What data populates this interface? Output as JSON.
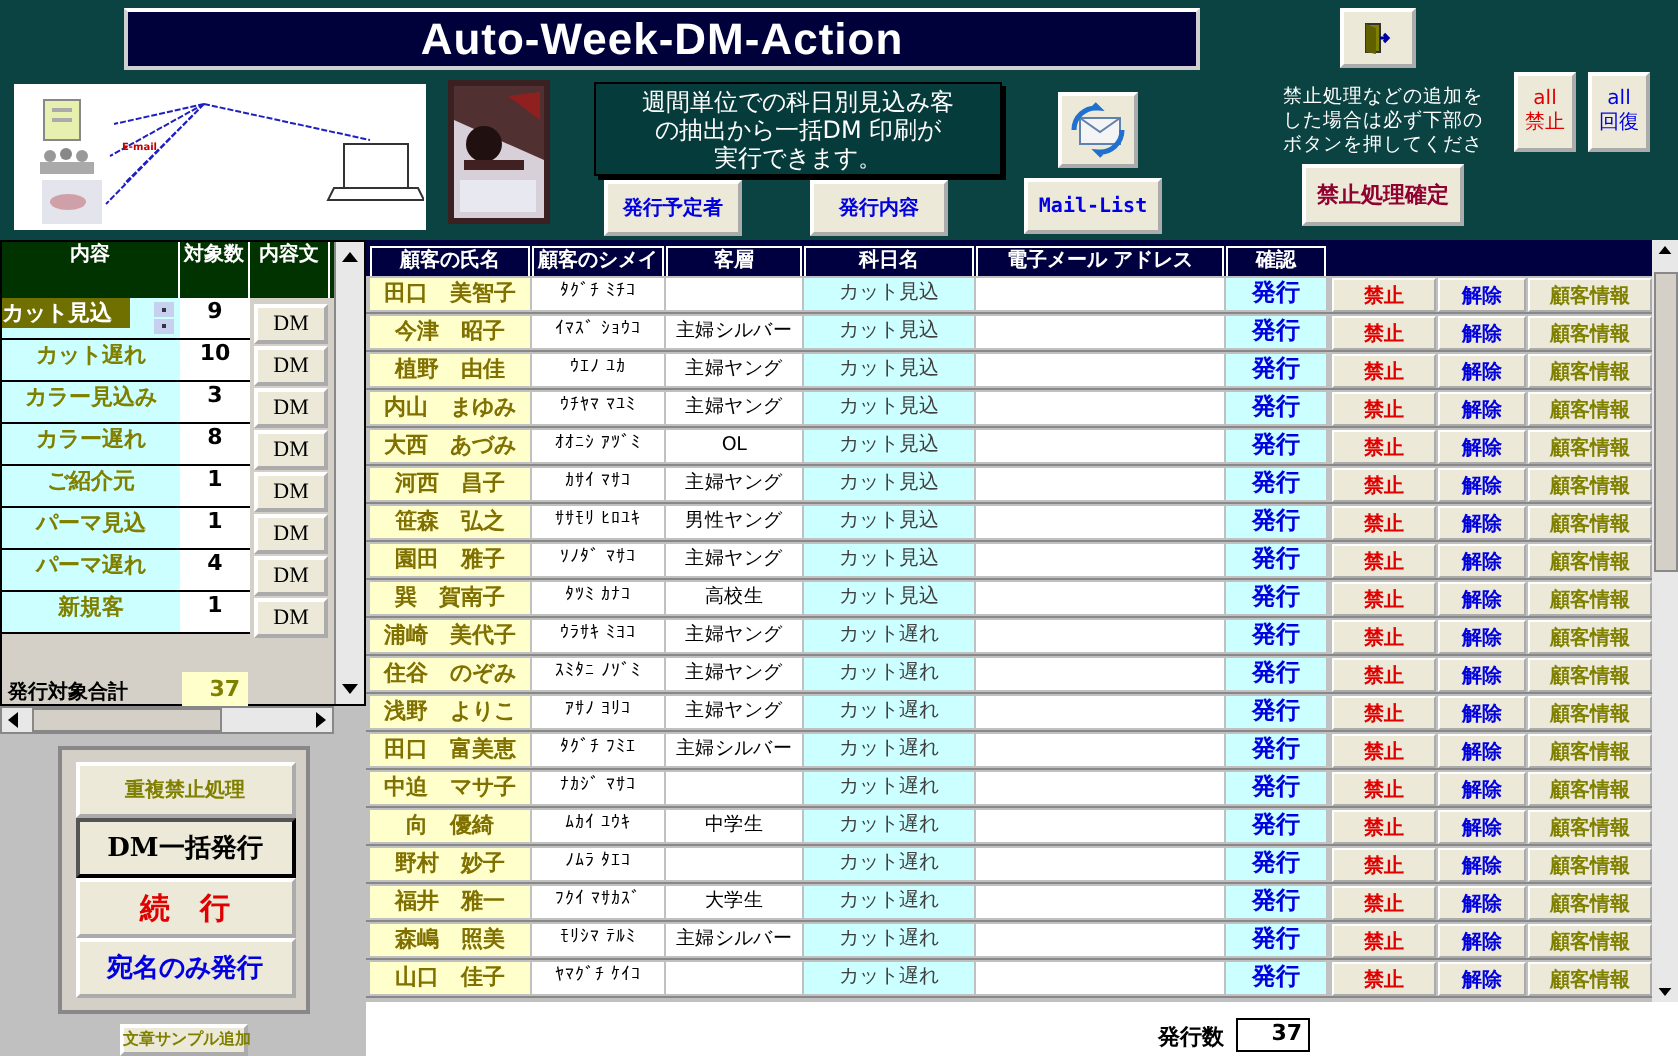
{
  "title": "Auto-Week-DM-Action",
  "diagram": {
    "label": "E-mail"
  },
  "description": [
    "週間単位での科日別見込み客",
    "の抽出から一括DM 印刷が",
    "実行できます。"
  ],
  "top_buttons": [
    {
      "label": "発行予定者"
    },
    {
      "label": "発行内容"
    },
    {
      "label": "Mail-List"
    }
  ],
  "notice": [
    "禁止処理などの追加を",
    "した場合は必ず下部の",
    "ボタンを押してくださ"
  ],
  "confirm_button": "禁止処理確定",
  "all_buttons": [
    {
      "lines": [
        "all",
        "禁止"
      ],
      "kind": "ban"
    },
    {
      "lines": [
        "all",
        "回復"
      ],
      "kind": "restore"
    }
  ],
  "categories": {
    "columns": [
      "内容",
      "対象数",
      "内容文"
    ],
    "rows": [
      {
        "name": "カット見込",
        "count": "9",
        "button": "DM",
        "selected": true
      },
      {
        "name": "カット遅れ",
        "count": "10",
        "button": "DM",
        "selected": false
      },
      {
        "name": "カラー見込み",
        "count": "3",
        "button": "DM",
        "selected": false
      },
      {
        "name": "カラー遅れ",
        "count": "8",
        "button": "DM",
        "selected": false
      },
      {
        "name": "ご紹介元",
        "count": "1",
        "button": "DM",
        "selected": false
      },
      {
        "name": "パーマ見込",
        "count": "1",
        "button": "DM",
        "selected": false
      },
      {
        "name": "パーマ遅れ",
        "count": "4",
        "button": "DM",
        "selected": false
      },
      {
        "name": "新規客",
        "count": "1",
        "button": "DM",
        "selected": false
      }
    ],
    "total_label": "発行対象合計",
    "total": "37"
  },
  "actions": [
    {
      "label": "重複禁止処理",
      "kind": "muted"
    },
    {
      "label": "DM一括発行",
      "kind": "primary"
    },
    {
      "label": "続　行",
      "kind": "danger"
    },
    {
      "label": "宛名のみ発行",
      "kind": "link"
    },
    {
      "label": "文章サンプル追加",
      "kind": "muted"
    }
  ],
  "customers": {
    "columns": [
      "顧客の氏名",
      "顧客のシメイ",
      "客層",
      "科日名",
      "電子メール アドレス",
      "確認"
    ],
    "rows": [
      {
        "name": "田口　美智子",
        "kana": "ﾀｸﾞﾁ ﾐﾁｺ",
        "subject": "カット見込",
        "confirm": "発行",
        "buttons": [
          {
            "label": "禁止",
            "kind": "ban"
          },
          {
            "label": "解除",
            "kind": "release"
          },
          {
            "label": "顧客情報",
            "kind": "info"
          }
        ]
      },
      {
        "name": "今津　昭子",
        "kana": "ｲﾏｽﾞ ｼｮｳｺ",
        "segment": "主婦シルバー",
        "subject": "カット見込",
        "confirm": "発行",
        "buttons": [
          {
            "label": "禁止",
            "kind": "ban"
          },
          {
            "label": "解除",
            "kind": "release"
          },
          {
            "label": "顧客情報",
            "kind": "info"
          }
        ]
      },
      {
        "name": "植野　由佳",
        "kana": "ｳｴﾉ ﾕｶ",
        "segment": "主婦ヤング",
        "subject": "カット見込",
        "confirm": "発行",
        "buttons": [
          {
            "label": "禁止",
            "kind": "ban"
          },
          {
            "label": "解除",
            "kind": "release"
          },
          {
            "label": "顧客情報",
            "kind": "info"
          }
        ]
      },
      {
        "name": "内山　まゆみ",
        "kana": "ｳﾁﾔﾏ ﾏﾕﾐ",
        "segment": "主婦ヤング",
        "subject": "カット見込",
        "confirm": "発行",
        "buttons": [
          {
            "label": "禁止",
            "kind": "ban"
          },
          {
            "label": "解除",
            "kind": "release"
          },
          {
            "label": "顧客情報",
            "kind": "info"
          }
        ]
      },
      {
        "name": "大西　あづみ",
        "kana": "ｵｵﾆｼ ｱﾂﾞﾐ",
        "segment": "OL",
        "subject": "カット見込",
        "confirm": "発行",
        "buttons": [
          {
            "label": "禁止",
            "kind": "ban"
          },
          {
            "label": "解除",
            "kind": "release"
          },
          {
            "label": "顧客情報",
            "kind": "info"
          }
        ]
      },
      {
        "name": "河西　昌子",
        "kana": "ｶｻｲ ﾏｻｺ",
        "segment": "主婦ヤング",
        "subject": "カット見込",
        "confirm": "発行",
        "buttons": [
          {
            "label": "禁止",
            "kind": "ban"
          },
          {
            "label": "解除",
            "kind": "release"
          },
          {
            "label": "顧客情報",
            "kind": "info"
          }
        ]
      },
      {
        "name": "笹森　弘之",
        "kana": "ｻｻﾓﾘ ﾋﾛﾕｷ",
        "segment": "男性ヤング",
        "subject": "カット見込",
        "confirm": "発行",
        "buttons": [
          {
            "label": "禁止",
            "kind": "ban"
          },
          {
            "label": "解除",
            "kind": "release"
          },
          {
            "label": "顧客情報",
            "kind": "info"
          }
        ]
      },
      {
        "name": "園田　雅子",
        "kana": "ｿﾉﾀﾞ ﾏｻｺ",
        "segment": "主婦ヤング",
        "subject": "カット見込",
        "confirm": "発行",
        "buttons": [
          {
            "label": "禁止",
            "kind": "ban"
          },
          {
            "label": "解除",
            "kind": "release"
          },
          {
            "label": "顧客情報",
            "kind": "info"
          }
        ]
      },
      {
        "name": "巽　賀南子",
        "kana": "ﾀﾂﾐ ｶﾅｺ",
        "segment": "高校生",
        "subject": "カット見込",
        "confirm": "発行",
        "buttons": [
          {
            "label": "禁止",
            "kind": "ban"
          },
          {
            "label": "解除",
            "kind": "release"
          },
          {
            "label": "顧客情報",
            "kind": "info"
          }
        ]
      },
      {
        "name": "浦崎　美代子",
        "kana": "ｳﾗｻｷ ﾐﾖｺ",
        "segment": "主婦ヤング",
        "subject": "カット遅れ",
        "confirm": "発行",
        "buttons": [
          {
            "label": "禁止",
            "kind": "ban"
          },
          {
            "label": "解除",
            "kind": "release"
          },
          {
            "label": "顧客情報",
            "kind": "info"
          }
        ]
      },
      {
        "name": "住谷　のぞみ",
        "kana": "ｽﾐﾀﾆ ﾉｿﾞﾐ",
        "segment": "主婦ヤング",
        "subject": "カット遅れ",
        "confirm": "発行",
        "buttons": [
          {
            "label": "禁止",
            "kind": "ban"
          },
          {
            "label": "解除",
            "kind": "release"
          },
          {
            "label": "顧客情報",
            "kind": "info"
          }
        ]
      },
      {
        "name": "浅野　よりこ",
        "kana": "ｱｻﾉ ﾖﾘｺ",
        "segment": "主婦ヤング",
        "subject": "カット遅れ",
        "confirm": "発行",
        "buttons": [
          {
            "label": "禁止",
            "kind": "ban"
          },
          {
            "label": "解除",
            "kind": "release"
          },
          {
            "label": "顧客情報",
            "kind": "info"
          }
        ]
      },
      {
        "name": "田口　富美恵",
        "kana": "ﾀｸﾞﾁ ﾌﾐｴ",
        "segment": "主婦シルバー",
        "subject": "カット遅れ",
        "confirm": "発行",
        "buttons": [
          {
            "label": "禁止",
            "kind": "ban"
          },
          {
            "label": "解除",
            "kind": "release"
          },
          {
            "label": "顧客情報",
            "kind": "info"
          }
        ]
      },
      {
        "name": "中迫　マサ子",
        "kana": "ﾅｶｼﾞ ﾏｻｺ",
        "subject": "カット遅れ",
        "confirm": "発行",
        "buttons": [
          {
            "label": "禁止",
            "kind": "ban"
          },
          {
            "label": "解除",
            "kind": "release"
          },
          {
            "label": "顧客情報",
            "kind": "info"
          }
        ]
      },
      {
        "name": "向　優綺",
        "kana": "ﾑｶｲ ﾕｳｷ",
        "segment": "中学生",
        "subject": "カット遅れ",
        "confirm": "発行",
        "buttons": [
          {
            "label": "禁止",
            "kind": "ban"
          },
          {
            "label": "解除",
            "kind": "release"
          },
          {
            "label": "顧客情報",
            "kind": "info"
          }
        ]
      },
      {
        "name": "野村　妙子",
        "kana": "ﾉﾑﾗ ﾀｴｺ",
        "subject": "カット遅れ",
        "confirm": "発行",
        "buttons": [
          {
            "label": "禁止",
            "kind": "ban"
          },
          {
            "label": "解除",
            "kind": "release"
          },
          {
            "label": "顧客情報",
            "kind": "info"
          }
        ]
      },
      {
        "name": "福井　雅一",
        "kana": "ﾌｸｲ ﾏｻｶｽﾞ",
        "segment": "大学生",
        "subject": "カット遅れ",
        "confirm": "発行",
        "buttons": [
          {
            "label": "禁止",
            "kind": "ban"
          },
          {
            "label": "解除",
            "kind": "release"
          },
          {
            "label": "顧客情報",
            "kind": "info"
          }
        ]
      },
      {
        "name": "森嶋　照美",
        "kana": "ﾓﾘｼﾏ ﾃﾙﾐ",
        "segment": "主婦シルバー",
        "subject": "カット遅れ",
        "confirm": "発行",
        "buttons": [
          {
            "label": "禁止",
            "kind": "ban"
          },
          {
            "label": "解除",
            "kind": "release"
          },
          {
            "label": "顧客情報",
            "kind": "info"
          }
        ]
      },
      {
        "name": "山口　佳子",
        "kana": "ﾔﾏｸﾞﾁ ｹｲｺ",
        "subject": "カット遅れ",
        "confirm": "発行",
        "buttons": [
          {
            "label": "禁止",
            "kind": "ban"
          },
          {
            "label": "解除",
            "kind": "release"
          },
          {
            "label": "顧客情報",
            "kind": "info"
          }
        ]
      }
    ]
  },
  "issued": {
    "label": "発行数",
    "value": "37"
  }
}
